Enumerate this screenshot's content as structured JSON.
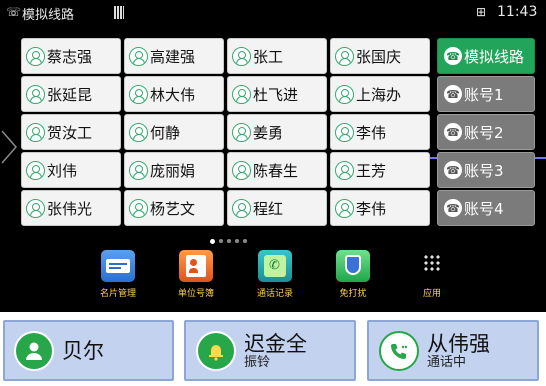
{
  "status_bar": {
    "line_icon": "phone-line-icon",
    "title": "模拟线路",
    "network_icon": "ethernet-icon",
    "time": "11:43"
  },
  "contacts": [
    [
      "蔡志强",
      "高建强",
      "张工",
      "张国庆"
    ],
    [
      "张延昆",
      "林大伟",
      "杜飞进",
      "上海办"
    ],
    [
      "贺汝工",
      "何静",
      "姜勇",
      "李伟"
    ],
    [
      "刘伟",
      "庞丽娟",
      "陈春生",
      "王芳"
    ],
    [
      "张伟光",
      "杨艺文",
      "程红",
      "李伟"
    ]
  ],
  "lines": [
    {
      "label": "模拟线路",
      "active": true
    },
    {
      "label": "账号1",
      "active": false
    },
    {
      "label": "账号2",
      "active": false
    },
    {
      "label": "账号3",
      "active": false
    },
    {
      "label": "账号4",
      "active": false
    }
  ],
  "page_indicator": {
    "count": 5,
    "current": 1
  },
  "apps": [
    {
      "label": "名片管理",
      "icon": "card-manager-icon"
    },
    {
      "label": "单位号簿",
      "icon": "directory-icon"
    },
    {
      "label": "通话记录",
      "icon": "call-log-icon"
    },
    {
      "label": "免打扰",
      "icon": "do-not-disturb-icon"
    },
    {
      "label": "应用",
      "icon": "app-grid-icon"
    }
  ],
  "calls": [
    {
      "name": "贝尔",
      "status": "",
      "icon": "person-icon",
      "color": "#27a64a"
    },
    {
      "name": "迟金全",
      "status": "振铃",
      "icon": "ringing-bell-icon",
      "color": "#27a64a"
    },
    {
      "name": "从伟强",
      "status": "通话中",
      "icon": "in-call-phone-icon",
      "color": "#27a64a"
    }
  ],
  "colors": {
    "accent_green": "#22a55a",
    "call_panel": "#c3d3ef",
    "app_label": "#ffd24a"
  }
}
